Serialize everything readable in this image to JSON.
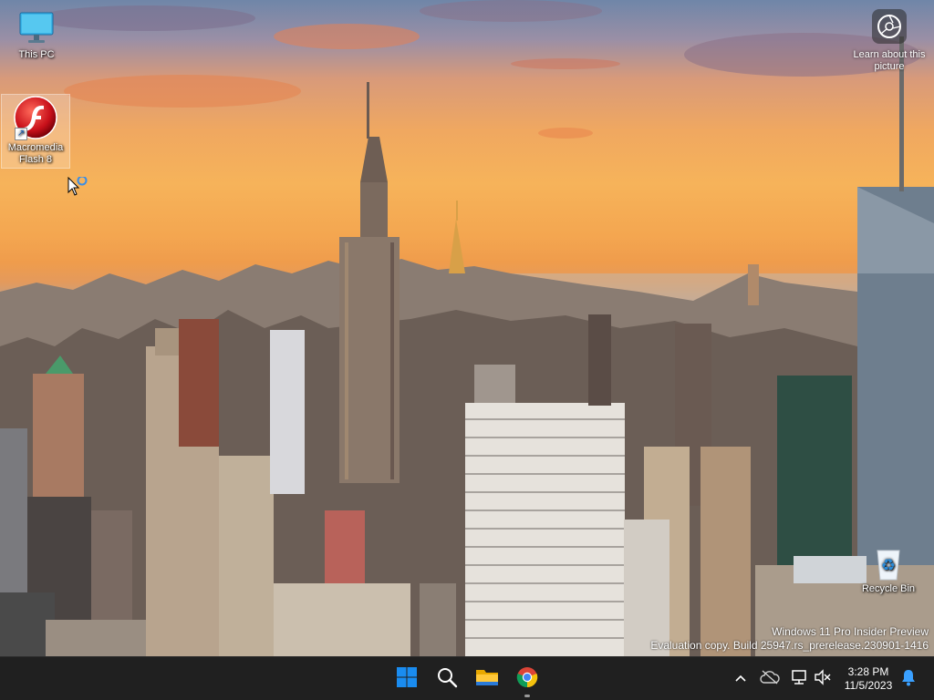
{
  "desktop": {
    "icons": [
      {
        "label": "This PC",
        "icon": "this-pc-icon"
      },
      {
        "label": "Macromedia Flash 8",
        "icon": "flash-icon"
      },
      {
        "label": "Recycle Bin",
        "icon": "recycle-bin-icon"
      }
    ],
    "learn_about": {
      "label": "Learn about this picture",
      "icon": "camera-icon"
    },
    "watermark": {
      "line1": "Windows 11 Pro Insider Preview",
      "line2": "Evaluation copy. Build 25947.rs_prerelease.230901-1416"
    }
  },
  "taskbar": {
    "apps": [
      {
        "name": "Start",
        "icon": "windows-logo-icon"
      },
      {
        "name": "Search",
        "icon": "search-icon"
      },
      {
        "name": "File Explorer",
        "icon": "folder-icon"
      },
      {
        "name": "Google Chrome",
        "icon": "chrome-icon",
        "running": true
      }
    ],
    "tray": {
      "icons": [
        "chevron-up-icon",
        "onedrive-icon",
        "network-icon",
        "volume-muted-icon",
        "bell-icon"
      ],
      "time": "3:28 PM",
      "date": "11/5/2023"
    }
  },
  "colors": {
    "taskbar_bg": "#202020",
    "start_blue": "#0078d4",
    "accent_notification": "#3aa0ff"
  }
}
